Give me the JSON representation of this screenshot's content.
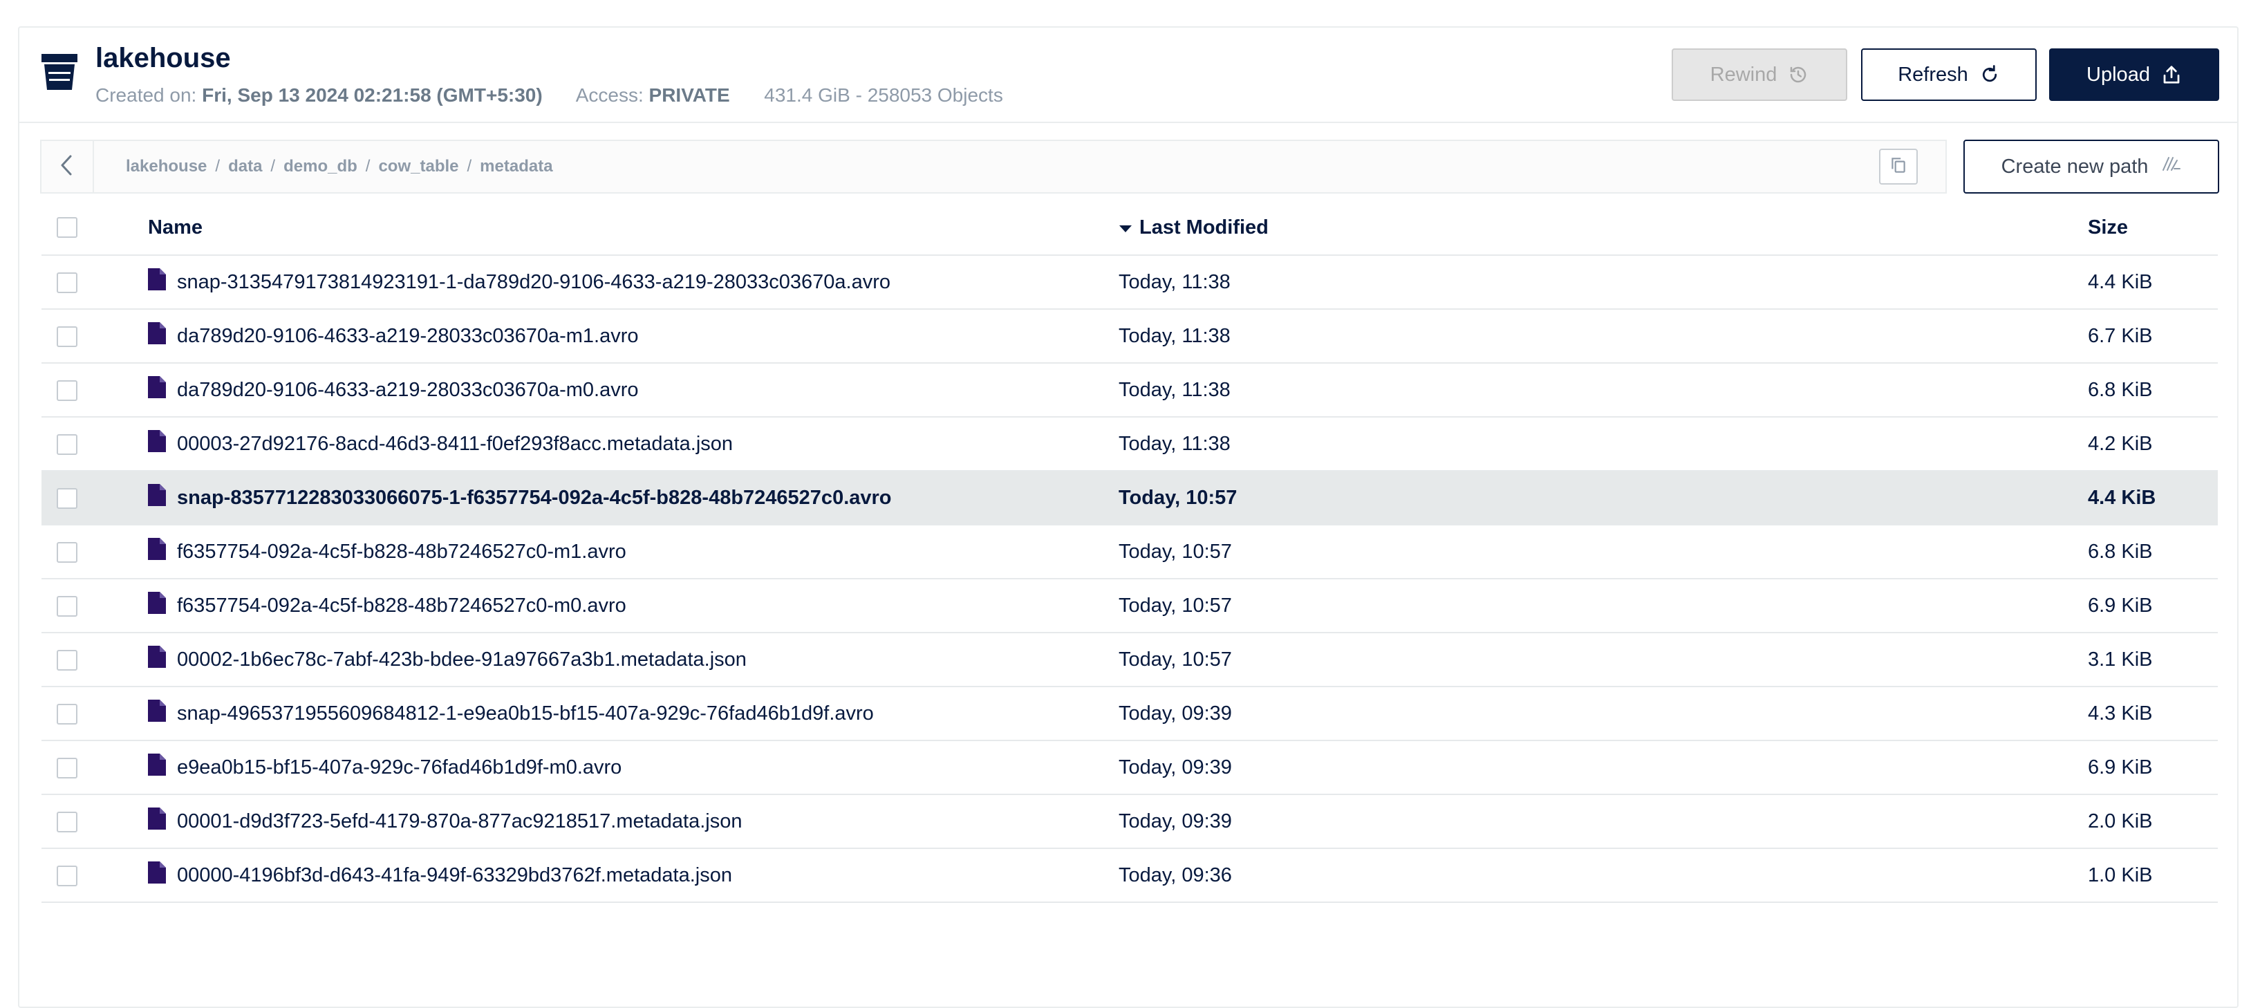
{
  "bucket": {
    "title": "lakehouse",
    "created_label": "Created on:",
    "created_value": "Fri, Sep 13 2024 02:21:58 (GMT+5:30)",
    "access_label": "Access:",
    "access_value": "PRIVATE",
    "usage": "431.4 GiB - 258053 Objects"
  },
  "toolbar": {
    "rewind_label": "Rewind",
    "refresh_label": "Refresh",
    "upload_label": "Upload",
    "new_path_label": "Create new path"
  },
  "breadcrumb": [
    "lakehouse",
    "data",
    "demo_db",
    "cow_table",
    "metadata"
  ],
  "table": {
    "columns": {
      "name": "Name",
      "modified": "Last Modified",
      "size": "Size"
    },
    "sort": {
      "column": "modified",
      "direction": "desc"
    },
    "rows": [
      {
        "name": "snap-3135479173814923191-1-da789d20-9106-4633-a219-28033c03670a.avro",
        "modified": "Today, 11:38",
        "size": "4.4 KiB",
        "selected": false
      },
      {
        "name": "da789d20-9106-4633-a219-28033c03670a-m1.avro",
        "modified": "Today, 11:38",
        "size": "6.7 KiB",
        "selected": false
      },
      {
        "name": "da789d20-9106-4633-a219-28033c03670a-m0.avro",
        "modified": "Today, 11:38",
        "size": "6.8 KiB",
        "selected": false
      },
      {
        "name": "00003-27d92176-8acd-46d3-8411-f0ef293f8acc.metadata.json",
        "modified": "Today, 11:38",
        "size": "4.2 KiB",
        "selected": false
      },
      {
        "name": "snap-8357712283033066075-1-f6357754-092a-4c5f-b828-48b7246527c0.avro",
        "modified": "Today, 10:57",
        "size": "4.4 KiB",
        "selected": true
      },
      {
        "name": "f6357754-092a-4c5f-b828-48b7246527c0-m1.avro",
        "modified": "Today, 10:57",
        "size": "6.8 KiB",
        "selected": false
      },
      {
        "name": "f6357754-092a-4c5f-b828-48b7246527c0-m0.avro",
        "modified": "Today, 10:57",
        "size": "6.9 KiB",
        "selected": false
      },
      {
        "name": "00002-1b6ec78c-7abf-423b-bdee-91a97667a3b1.metadata.json",
        "modified": "Today, 10:57",
        "size": "3.1 KiB",
        "selected": false
      },
      {
        "name": "snap-4965371955609684812-1-e9ea0b15-bf15-407a-929c-76fad46b1d9f.avro",
        "modified": "Today, 09:39",
        "size": "4.3 KiB",
        "selected": false
      },
      {
        "name": "e9ea0b15-bf15-407a-929c-76fad46b1d9f-m0.avro",
        "modified": "Today, 09:39",
        "size": "6.9 KiB",
        "selected": false
      },
      {
        "name": "00001-d9d3f723-5efd-4179-870a-877ac9218517.metadata.json",
        "modified": "Today, 09:39",
        "size": "2.0 KiB",
        "selected": false
      },
      {
        "name": "00000-4196bf3d-d643-41fa-949f-63329bd3762f.metadata.json",
        "modified": "Today, 09:36",
        "size": "1.0 KiB",
        "selected": false
      }
    ]
  },
  "icons": {
    "bucket": "bucket-icon",
    "file": "file-icon",
    "back": "chevron-left-icon",
    "copy": "copy-icon",
    "rewind": "history-icon",
    "refresh": "refresh-icon",
    "upload": "upload-icon",
    "new_path": "new-path-icon",
    "sort": "sort-desc-icon"
  },
  "colors": {
    "primary": "#081c42",
    "file_icon": "#2b1264",
    "muted_text": "#8e9aa8",
    "selected_row": "#e6e9ea",
    "disabled_button": "#e6e6e6"
  }
}
